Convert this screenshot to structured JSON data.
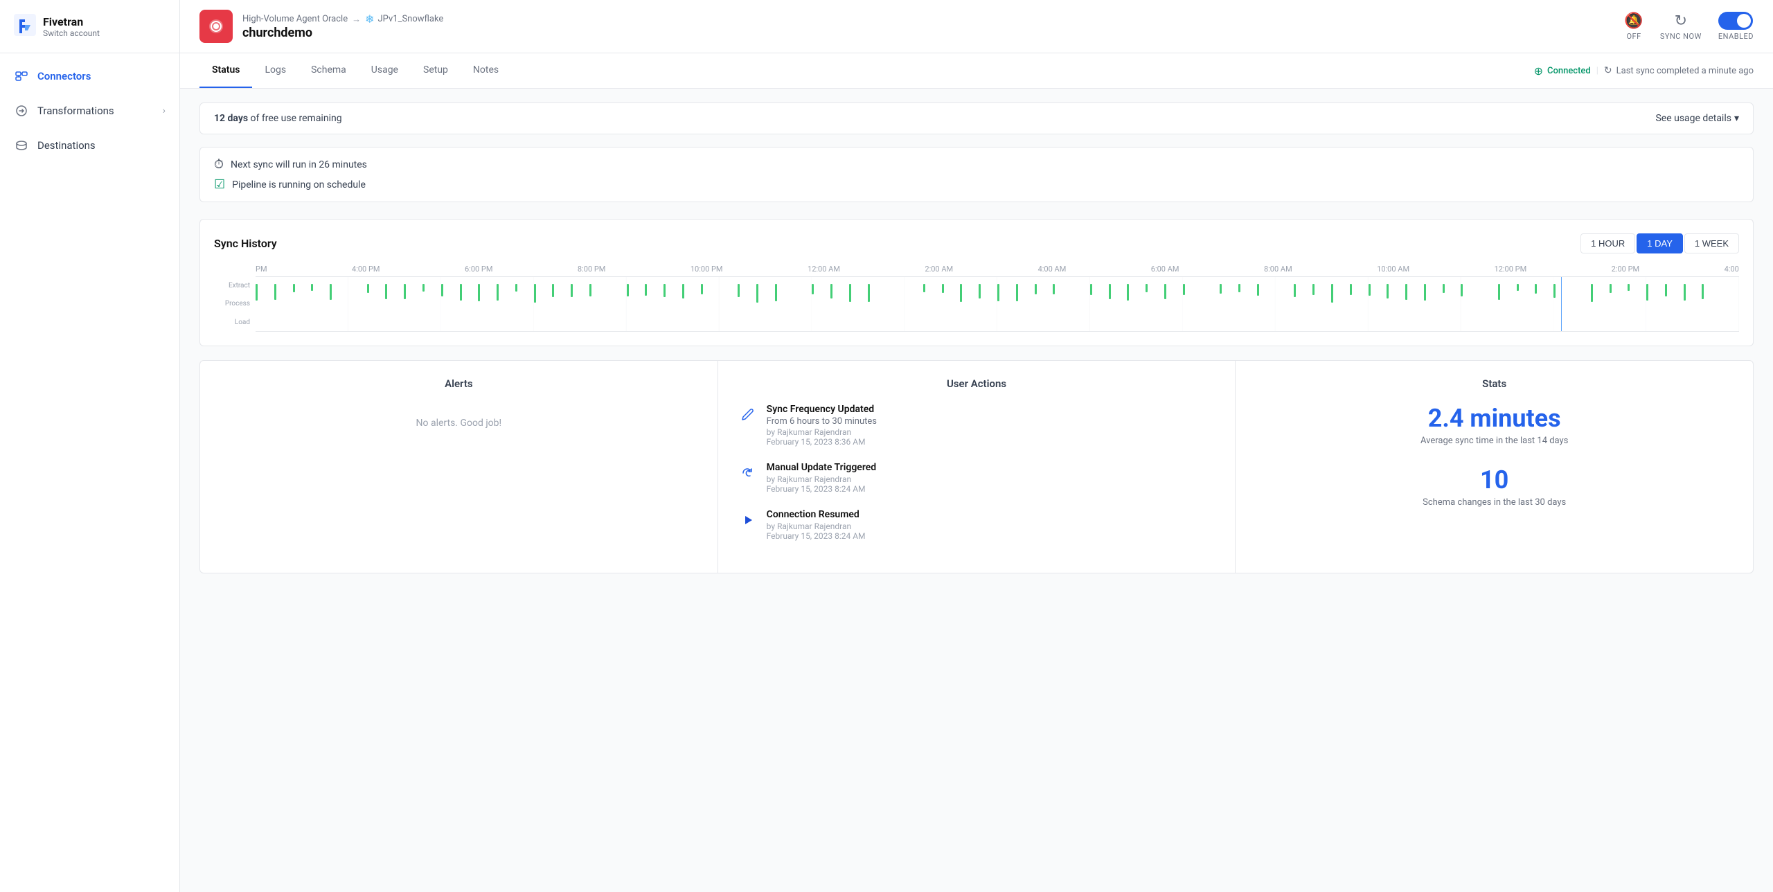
{
  "sidebar": {
    "logo": {
      "name": "Fivetran",
      "sub": "Switch account"
    },
    "items": [
      {
        "id": "connectors",
        "label": "Connectors",
        "active": true
      },
      {
        "id": "transformations",
        "label": "Transformations",
        "active": false
      },
      {
        "id": "destinations",
        "label": "Destinations",
        "active": false
      }
    ]
  },
  "header": {
    "connector_source": "High-Volume Agent Oracle",
    "arrow": "→",
    "destination_name": "JPv1_Snowflake",
    "connector_account": "churchdemo",
    "sync_now_label": "SYNC NOW",
    "off_label": "OFF",
    "enabled_label": "ENABLED"
  },
  "tabs": {
    "items": [
      {
        "id": "status",
        "label": "Status",
        "active": true
      },
      {
        "id": "logs",
        "label": "Logs",
        "active": false
      },
      {
        "id": "schema",
        "label": "Schema",
        "active": false
      },
      {
        "id": "usage",
        "label": "Usage",
        "active": false
      },
      {
        "id": "setup",
        "label": "Setup",
        "active": false
      },
      {
        "id": "notes",
        "label": "Notes",
        "active": false
      }
    ],
    "connection_status": "Connected",
    "sync_status": "Last sync completed a minute ago"
  },
  "free_banner": {
    "days": "12 days",
    "text": " of free use remaining",
    "see_usage": "See usage details"
  },
  "info_items": [
    {
      "text": "Next sync will run in 26 minutes",
      "icon_type": "clock"
    },
    {
      "text": "Pipeline is running on schedule",
      "icon_type": "check"
    }
  ],
  "sync_history": {
    "title": "Sync History",
    "time_range_buttons": [
      {
        "id": "1hour",
        "label": "1 HOUR",
        "active": false
      },
      {
        "id": "1day",
        "label": "1 DAY",
        "active": true
      },
      {
        "id": "1week",
        "label": "1 WEEK",
        "active": false
      }
    ],
    "x_labels": [
      "PM",
      "4:00 PM",
      "6:00 PM",
      "8:00 PM",
      "10:00 PM",
      "12:00 AM",
      "2:00 AM",
      "4:00 AM",
      "6:00 AM",
      "8:00 AM",
      "10:00 AM",
      "12:00 PM",
      "2:00 PM",
      "4:00"
    ],
    "y_labels": [
      "Extract",
      "Process",
      "Load"
    ],
    "current_time_pct": 90
  },
  "alerts": {
    "title": "Alerts",
    "empty_message": "No alerts. Good job!"
  },
  "user_actions": {
    "title": "User Actions",
    "items": [
      {
        "id": "sync-freq",
        "icon": "edit",
        "icon_color": "#2563eb",
        "title": "Sync Frequency Updated",
        "subtitle": "From 6 hours to 30 minutes",
        "by": "by Rajkumar Rajendran",
        "date": "February 15, 2023 8:36 AM"
      },
      {
        "id": "manual-update",
        "icon": "refresh",
        "icon_color": "#2563eb",
        "title": "Manual Update Triggered",
        "subtitle": "",
        "by": "by Rajkumar Rajendran",
        "date": "February 15, 2023 8:24 AM"
      },
      {
        "id": "conn-resumed",
        "icon": "play",
        "icon_color": "#1d4ed8",
        "title": "Connection Resumed",
        "subtitle": "",
        "by": "by Rajkumar Rajendran",
        "date": "February 15, 2023 8:24 AM"
      }
    ]
  },
  "stats": {
    "title": "Stats",
    "items": [
      {
        "value": "2.4 minutes",
        "label": "Average sync time in the last 14 days"
      },
      {
        "value": "10",
        "label": "Schema changes in the last 30 days"
      }
    ]
  }
}
